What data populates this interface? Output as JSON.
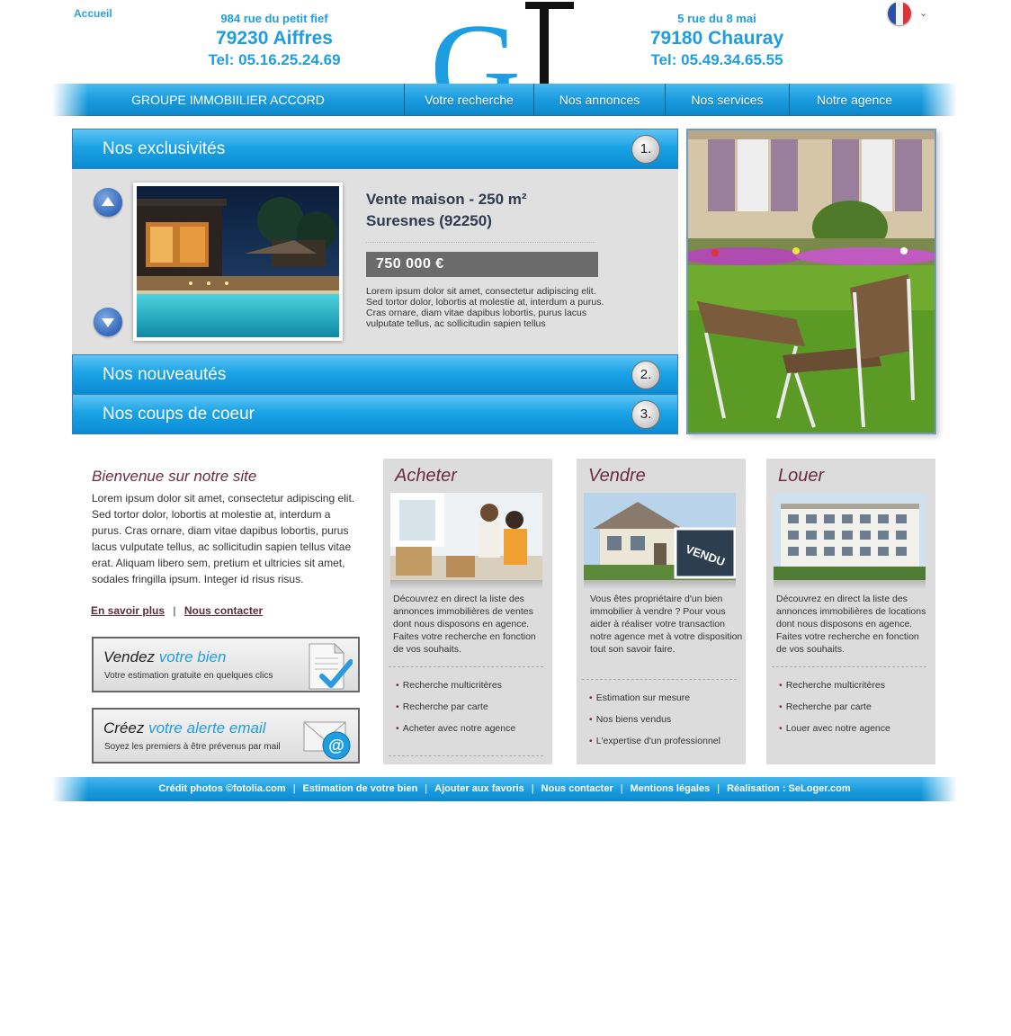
{
  "header": {
    "home_link": "Accueil",
    "left_office": {
      "street": "984 rue du petit fief",
      "city": "79230 Aiffres",
      "tel": "Tel: 05.16.25.24.69"
    },
    "right_office": {
      "street": "5 rue du 8 mai",
      "city": "79180 Chauray",
      "tel": "Tel: 05.49.34.65.55"
    },
    "logo_text": "GI",
    "language": "fr-flag-icon"
  },
  "nav": {
    "brand": "GROUPE IMMOBIILIER ACCORD",
    "items": [
      "Votre recherche",
      "Nos annonces",
      "Nos services",
      "Notre agence"
    ]
  },
  "slider": {
    "tabs": [
      {
        "label": "Nos exclusivités",
        "num": "1."
      },
      {
        "label": "Nos nouveautés",
        "num": "2."
      },
      {
        "label": "Nos coups de coeur",
        "num": "3."
      }
    ],
    "listing": {
      "title_line1": "Vente maison - 250 m²",
      "title_line2": "Suresnes (92250)",
      "price": "750 000 €",
      "description": "Lorem ipsum dolor sit amet, consectetur adipiscing elit. Sed tortor dolor, lobortis at molestie at, interdum a purus. Cras ornare, diam vitae dapibus lobortis, purus lacus vulputate tellus, ac sollicitudin sapien tellus"
    }
  },
  "welcome": {
    "title": "Bienvenue sur notre site",
    "text": "Lorem ipsum dolor sit amet, consectetur adipiscing elit. Sed tortor dolor, lobortis at molestie at, interdum a purus. Cras ornare, diam vitae dapibus lobortis, purus lacus vulputate tellus, ac sollicitudin sapien tellus vitae erat. Aliquam libero sem, pretium et ultricies sit amet, sodales fringilla ipsum. Integer id risus risus.",
    "link_more": "En savoir plus",
    "link_sep": "|",
    "link_contact": "Nous contacter"
  },
  "promos": {
    "sell": {
      "title_a": "Vendez",
      "title_b": "votre bien",
      "subtitle": "Votre estimation gratuite en quelques clics"
    },
    "alert": {
      "title_a": "Créez",
      "title_b": "votre alerte email",
      "subtitle": "Soyez les premiers à être prévenus par mail"
    }
  },
  "cards": {
    "buy": {
      "title": "Acheter",
      "text": "Découvrez en direct la liste des annonces immobilières de ventes dont nous disposons en agence. Faites votre recherche en fonction de vos souhaits.",
      "links": [
        "Recherche multicritères",
        "Recherche par carte",
        "Acheter avec notre agence"
      ]
    },
    "sell": {
      "title": "Vendre",
      "text": "Vous êtes propriétaire d'un bien immobilier à vendre ? Pour vous aider à réaliser votre transaction notre agence met à votre disposition tout son savoir faire.",
      "sign": "VENDU",
      "links": [
        "Estimation sur mesure",
        "Nos biens vendus",
        "L'expertise d'un professionnel"
      ]
    },
    "rent": {
      "title": "Louer",
      "text": "Découvrez en direct la liste des annonces immobilières de locations dont nous disposons en agence. Faites votre recherche en fonction de vos souhaits.",
      "links": [
        "Recherche multicritères",
        "Recherche par carte",
        "Louer avec notre agence"
      ]
    }
  },
  "footer": {
    "links": [
      "Crédit photos ©fotolia.com",
      "Estimation de votre bien",
      "Ajouter aux favoris",
      "Nous contacter",
      "Mentions légales",
      "Réalisation : SeLoger.com"
    ],
    "separator": "|"
  },
  "colors": {
    "accent": "#1e9ee0",
    "title_wine": "#6b2b43",
    "panel": "#e0e0e0",
    "price_bg": "#6b6b6b"
  }
}
